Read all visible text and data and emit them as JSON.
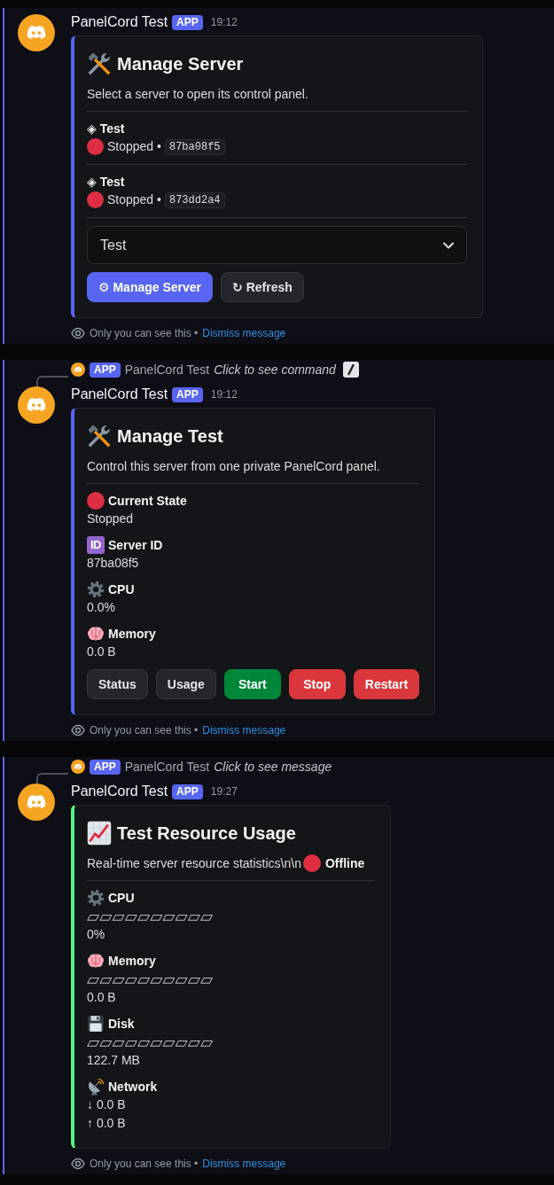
{
  "messages": [
    {
      "author": "PanelCord Test",
      "badge": "APP",
      "time": "19:12",
      "embed": {
        "color": "#5865f2",
        "title": "Manage Server",
        "description": "Select a server to open its control panel.",
        "servers": [
          {
            "name": "◈ Test",
            "color": "#dd2e44",
            "status": "Stopped •",
            "id": "87ba08f5"
          },
          {
            "name": "◈ Test",
            "color": "#dd2e44",
            "status": "Stopped •",
            "id": "873dd2a4"
          }
        ],
        "select": {
          "value": "Test"
        },
        "buttons": [
          {
            "label": "⚙ Manage Server",
            "kind": "primary"
          },
          {
            "label": "↻ Refresh",
            "kind": "secondary"
          }
        ]
      },
      "footer": {
        "note": "Only you can see this •",
        "link": "Dismiss message"
      }
    },
    {
      "reply": {
        "badge": "APP",
        "author": "PanelCord Test",
        "text": "Click to see command",
        "command_icon": true
      },
      "author": "PanelCord Test",
      "badge": "APP",
      "time": "19:12",
      "embed": {
        "color": "#5865f2",
        "title": "Manage Test",
        "description": "Control this server from one private PanelCord panel.",
        "fields": [
          {
            "kind": "state",
            "color": "#dd2e44",
            "name": "Current State",
            "lines": [
              "Stopped"
            ]
          },
          {
            "kind": "id",
            "badge": "ID",
            "name": "Server ID",
            "lines": [
              "87ba08f5"
            ]
          },
          {
            "kind": "cpu",
            "name": "CPU",
            "lines": [
              "0.0%"
            ]
          },
          {
            "kind": "memory",
            "name": "Memory",
            "lines": [
              "0.0 B"
            ]
          }
        ],
        "buttons": [
          {
            "label": "Status",
            "kind": "secondary"
          },
          {
            "label": "Usage",
            "kind": "secondary"
          },
          {
            "label": "Start",
            "kind": "success"
          },
          {
            "label": "Stop",
            "kind": "danger"
          },
          {
            "label": "Restart",
            "kind": "danger"
          }
        ]
      },
      "footer": {
        "note": "Only you can see this •",
        "link": "Dismiss message"
      }
    },
    {
      "reply": {
        "badge": "APP",
        "author": "PanelCord Test",
        "text": "Click to see message"
      },
      "author": "PanelCord Test",
      "badge": "APP",
      "time": "19:27",
      "embed": {
        "color": "#57f287",
        "title": "Test Resource Usage",
        "description": "Real-time server resource statistics\\n\\n",
        "status": {
          "color": "#dd2e44",
          "label": "Offline"
        },
        "fields": [
          {
            "kind": "cpu",
            "name": "CPU",
            "bar": "▱▱▱▱▱▱▱▱▱▱",
            "lines": [
              "0%"
            ]
          },
          {
            "kind": "memory",
            "name": "Memory",
            "bar": "▱▱▱▱▱▱▱▱▱▱",
            "lines": [
              "0.0 B"
            ]
          },
          {
            "kind": "disk",
            "name": "Disk",
            "bar": "▱▱▱▱▱▱▱▱▱▱",
            "lines": [
              "122.7 MB"
            ]
          },
          {
            "kind": "network",
            "name": "Network",
            "lines": [
              "↓ 0.0 B",
              "↑ 0.0 B"
            ]
          }
        ]
      },
      "footer": {
        "note": "Only you can see this •",
        "link": "Dismiss message"
      }
    }
  ]
}
